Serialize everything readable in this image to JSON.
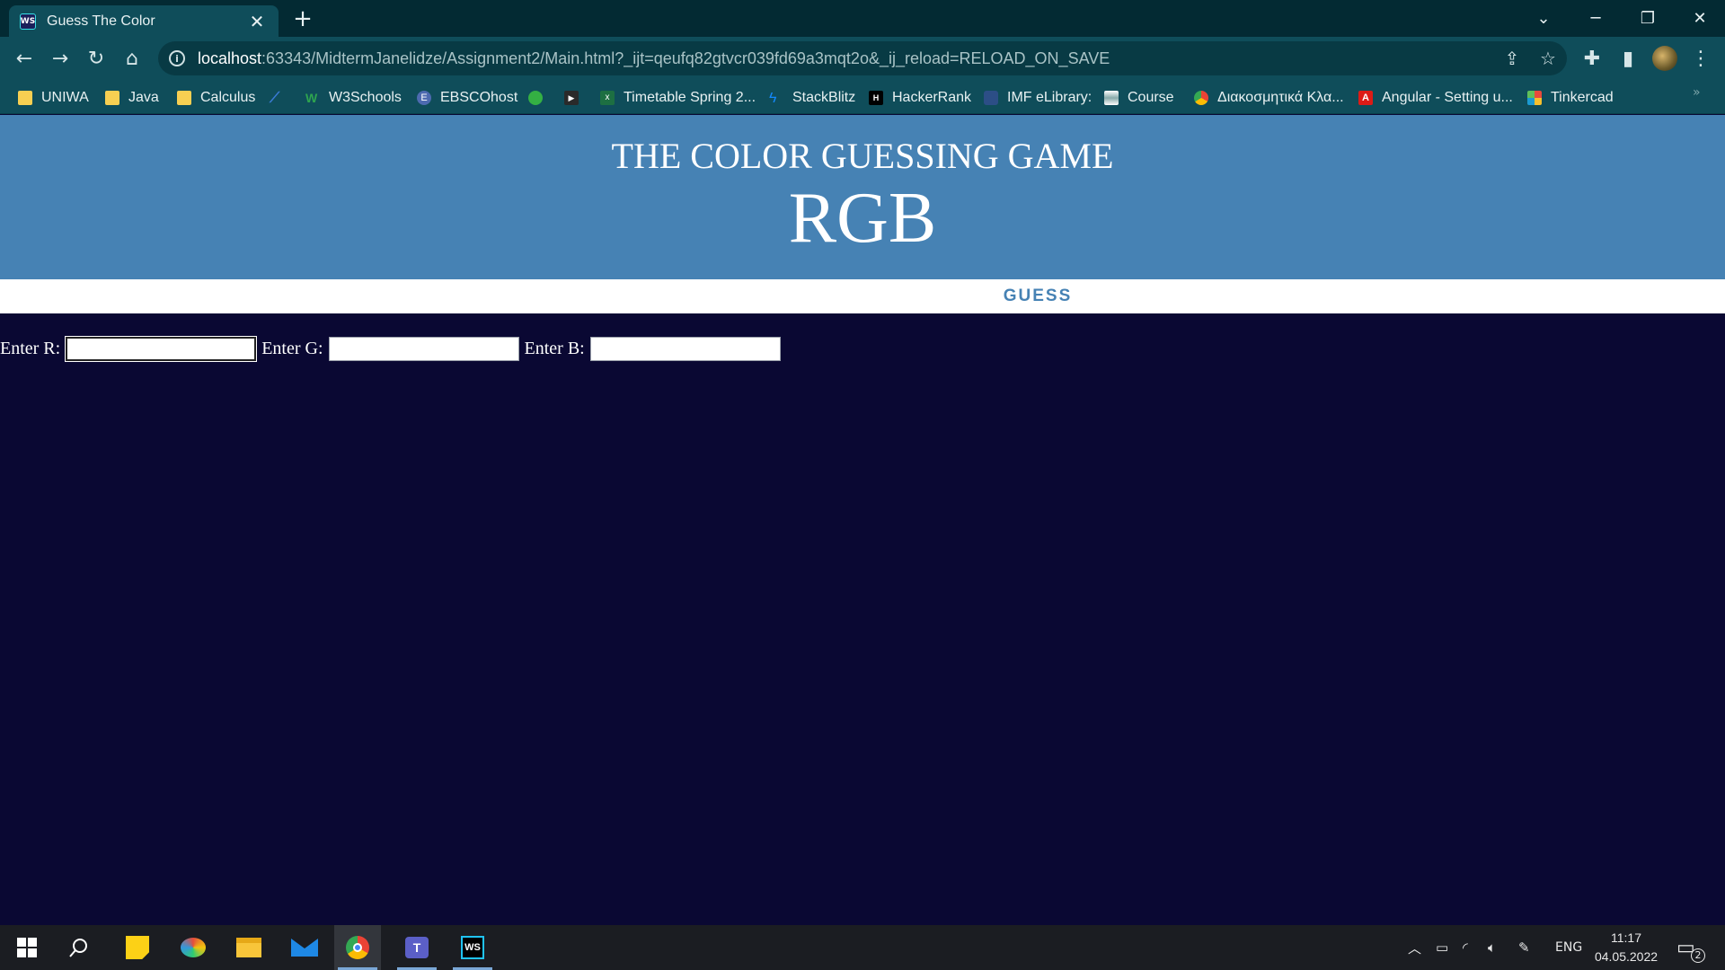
{
  "browser": {
    "tab_title": "Guess The Color",
    "tab_favicon_text": "WS",
    "new_tab": "+",
    "url_host": "localhost",
    "url_rest": ":63343/MidtermJanelidze/Assignment2/Main.html?_ijt=qeufq82gtvcr039fd69a3mqt2o&_ij_reload=RELOAD_ON_SAVE",
    "bookmarks": [
      {
        "label": "UNIWA",
        "icon": "folder-icon"
      },
      {
        "label": "Java",
        "icon": "folder-icon"
      },
      {
        "label": "Calculus",
        "icon": "folder-icon"
      },
      {
        "label": "",
        "icon": "app-icon"
      },
      {
        "label": "W3Schools",
        "icon": "w3schools-icon"
      },
      {
        "label": "EBSCOhost",
        "icon": "ebsco-icon"
      },
      {
        "label": "",
        "icon": "play-icon"
      },
      {
        "label": "",
        "icon": "youtube-icon"
      },
      {
        "label": "Timetable Spring 2...",
        "icon": "excel-icon"
      },
      {
        "label": "StackBlitz",
        "icon": "stackblitz-icon"
      },
      {
        "label": "HackerRank",
        "icon": "hackerrank-icon"
      },
      {
        "label": "IMF eLibrary:",
        "icon": "imf-icon"
      },
      {
        "label": "Course",
        "icon": "course-icon"
      },
      {
        "label": "Διακοσμητικά Κλα...",
        "icon": "chrome-icon"
      },
      {
        "label": "Angular - Setting u...",
        "icon": "angular-icon"
      },
      {
        "label": "Tinkercad",
        "icon": "tinkercad-icon"
      }
    ],
    "bookmarks_more": "»"
  },
  "page": {
    "subtitle": "THE COLOR GUESSING GAME",
    "title": "RGB",
    "guess_button": "GUESS",
    "inputs": [
      {
        "label": "Enter R:",
        "value": ""
      },
      {
        "label": "Enter G:",
        "value": ""
      },
      {
        "label": "Enter B:",
        "value": ""
      }
    ],
    "colors": {
      "header": "#4682b4",
      "background": "#0a0833",
      "accent": "#4682b4"
    }
  },
  "taskbar": {
    "tray_lang": "ENG",
    "time": "11:17",
    "date": "04.05.2022",
    "notification_count": "2"
  }
}
